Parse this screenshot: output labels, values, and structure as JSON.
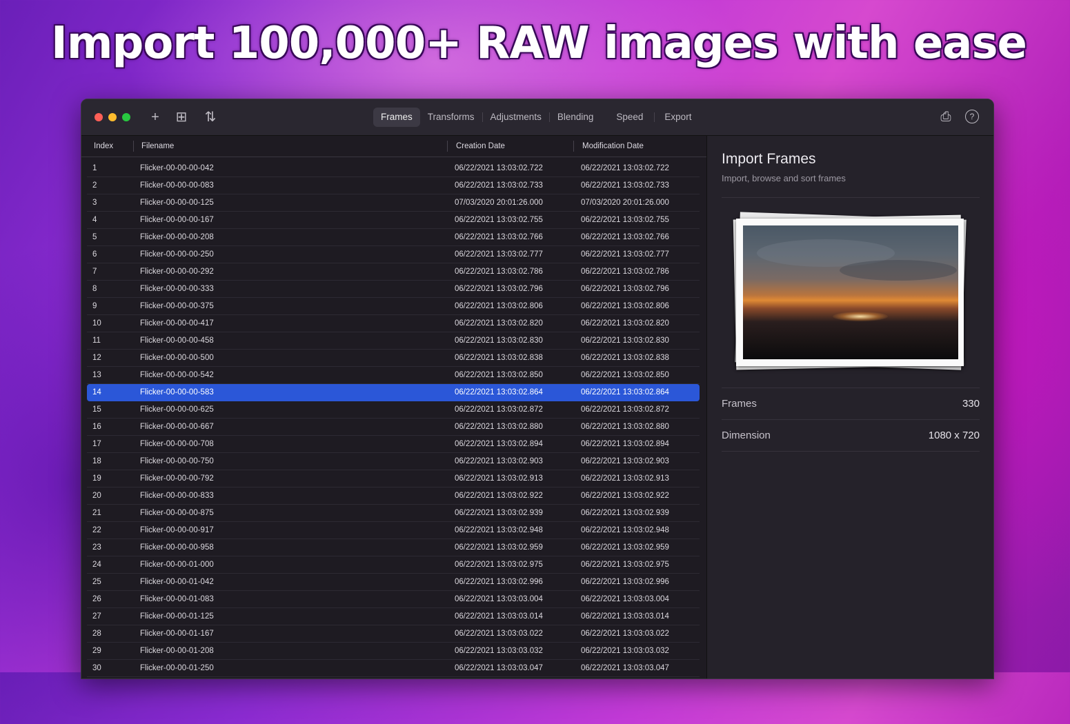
{
  "headline": "Import 100,000+ RAW images with ease",
  "toolbar": {
    "add_icon": "+",
    "grid_icon": "⊞",
    "sort_icon": "⇅",
    "tabs": [
      {
        "label": "Frames",
        "active": true
      },
      {
        "label": "Transforms",
        "active": false
      },
      {
        "label": "Adjustments",
        "active": false
      },
      {
        "label": "Blending",
        "active": false
      },
      {
        "label": "Speed",
        "active": false
      },
      {
        "label": "Export",
        "active": false
      }
    ],
    "export_icon": "⎙",
    "help_icon": "?"
  },
  "table": {
    "headers": {
      "index": "Index",
      "filename": "Filename",
      "creation": "Creation Date",
      "modification": "Modification Date"
    },
    "selected_index": 13,
    "rows": [
      [
        "1",
        "Flicker-00-00-00-042",
        "06/22/2021 13:03:02.722",
        "06/22/2021 13:03:02.722"
      ],
      [
        "2",
        "Flicker-00-00-00-083",
        "06/22/2021 13:03:02.733",
        "06/22/2021 13:03:02.733"
      ],
      [
        "3",
        "Flicker-00-00-00-125",
        "07/03/2020 20:01:26.000",
        "07/03/2020 20:01:26.000"
      ],
      [
        "4",
        "Flicker-00-00-00-167",
        "06/22/2021 13:03:02.755",
        "06/22/2021 13:03:02.755"
      ],
      [
        "5",
        "Flicker-00-00-00-208",
        "06/22/2021 13:03:02.766",
        "06/22/2021 13:03:02.766"
      ],
      [
        "6",
        "Flicker-00-00-00-250",
        "06/22/2021 13:03:02.777",
        "06/22/2021 13:03:02.777"
      ],
      [
        "7",
        "Flicker-00-00-00-292",
        "06/22/2021 13:03:02.786",
        "06/22/2021 13:03:02.786"
      ],
      [
        "8",
        "Flicker-00-00-00-333",
        "06/22/2021 13:03:02.796",
        "06/22/2021 13:03:02.796"
      ],
      [
        "9",
        "Flicker-00-00-00-375",
        "06/22/2021 13:03:02.806",
        "06/22/2021 13:03:02.806"
      ],
      [
        "10",
        "Flicker-00-00-00-417",
        "06/22/2021 13:03:02.820",
        "06/22/2021 13:03:02.820"
      ],
      [
        "11",
        "Flicker-00-00-00-458",
        "06/22/2021 13:03:02.830",
        "06/22/2021 13:03:02.830"
      ],
      [
        "12",
        "Flicker-00-00-00-500",
        "06/22/2021 13:03:02.838",
        "06/22/2021 13:03:02.838"
      ],
      [
        "13",
        "Flicker-00-00-00-542",
        "06/22/2021 13:03:02.850",
        "06/22/2021 13:03:02.850"
      ],
      [
        "14",
        "Flicker-00-00-00-583",
        "06/22/2021 13:03:02.864",
        "06/22/2021 13:03:02.864"
      ],
      [
        "15",
        "Flicker-00-00-00-625",
        "06/22/2021 13:03:02.872",
        "06/22/2021 13:03:02.872"
      ],
      [
        "16",
        "Flicker-00-00-00-667",
        "06/22/2021 13:03:02.880",
        "06/22/2021 13:03:02.880"
      ],
      [
        "17",
        "Flicker-00-00-00-708",
        "06/22/2021 13:03:02.894",
        "06/22/2021 13:03:02.894"
      ],
      [
        "18",
        "Flicker-00-00-00-750",
        "06/22/2021 13:03:02.903",
        "06/22/2021 13:03:02.903"
      ],
      [
        "19",
        "Flicker-00-00-00-792",
        "06/22/2021 13:03:02.913",
        "06/22/2021 13:03:02.913"
      ],
      [
        "20",
        "Flicker-00-00-00-833",
        "06/22/2021 13:03:02.922",
        "06/22/2021 13:03:02.922"
      ],
      [
        "21",
        "Flicker-00-00-00-875",
        "06/22/2021 13:03:02.939",
        "06/22/2021 13:03:02.939"
      ],
      [
        "22",
        "Flicker-00-00-00-917",
        "06/22/2021 13:03:02.948",
        "06/22/2021 13:03:02.948"
      ],
      [
        "23",
        "Flicker-00-00-00-958",
        "06/22/2021 13:03:02.959",
        "06/22/2021 13:03:02.959"
      ],
      [
        "24",
        "Flicker-00-00-01-000",
        "06/22/2021 13:03:02.975",
        "06/22/2021 13:03:02.975"
      ],
      [
        "25",
        "Flicker-00-00-01-042",
        "06/22/2021 13:03:02.996",
        "06/22/2021 13:03:02.996"
      ],
      [
        "26",
        "Flicker-00-00-01-083",
        "06/22/2021 13:03:03.004",
        "06/22/2021 13:03:03.004"
      ],
      [
        "27",
        "Flicker-00-00-01-125",
        "06/22/2021 13:03:03.014",
        "06/22/2021 13:03:03.014"
      ],
      [
        "28",
        "Flicker-00-00-01-167",
        "06/22/2021 13:03:03.022",
        "06/22/2021 13:03:03.022"
      ],
      [
        "29",
        "Flicker-00-00-01-208",
        "06/22/2021 13:03:03.032",
        "06/22/2021 13:03:03.032"
      ],
      [
        "30",
        "Flicker-00-00-01-250",
        "06/22/2021 13:03:03.047",
        "06/22/2021 13:03:03.047"
      ]
    ]
  },
  "sidebar": {
    "title": "Import Frames",
    "subtitle": "Import, browse and sort frames",
    "stats": [
      {
        "label": "Frames",
        "value": "330"
      },
      {
        "label": "Dimension",
        "value": "1080 x 720"
      }
    ]
  },
  "colors": {
    "selection": "#2b57d8",
    "window_bg": "#1e1b22",
    "sidebar_bg": "#25222a"
  }
}
